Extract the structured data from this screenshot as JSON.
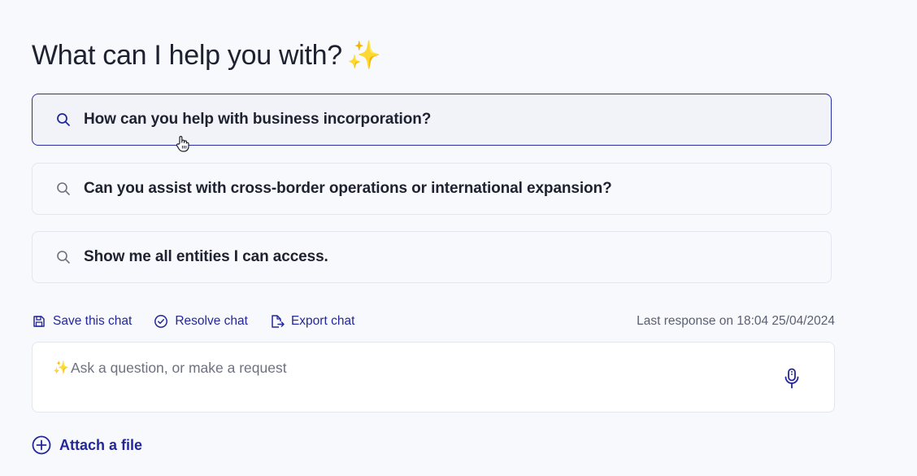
{
  "page": {
    "title": "What can I help you with?",
    "title_emoji": "✨"
  },
  "suggestions": [
    {
      "text": "How can you help with business incorporation?",
      "icon": "search-icon",
      "state": "hovered"
    },
    {
      "text": "Can you assist with cross-border operations or international expansion?",
      "icon": "search-icon"
    },
    {
      "text": "Show me all entities I can access.",
      "icon": "search-icon"
    }
  ],
  "actions": {
    "save_label": "Save this chat",
    "save_icon": "save-icon",
    "resolve_label": "Resolve chat",
    "resolve_icon": "check-circle-icon",
    "export_label": "Export chat",
    "export_icon": "export-icon"
  },
  "status": {
    "last_response": "Last response on 18:04 25/04/2024"
  },
  "composer": {
    "sparkle": "✨",
    "placeholder": "Ask a question, or make a request",
    "value": "",
    "mic_icon": "microphone-icon"
  },
  "attach": {
    "label": "Attach a file",
    "icon": "plus-circle-icon"
  },
  "colors": {
    "accent": "#23279a",
    "active_border": "#2a2fa8",
    "background": "#f8f9fc",
    "border": "#e3e6ee",
    "text": "#1e2230",
    "muted": "#5b6070",
    "sparkle": "#f2c94c"
  }
}
